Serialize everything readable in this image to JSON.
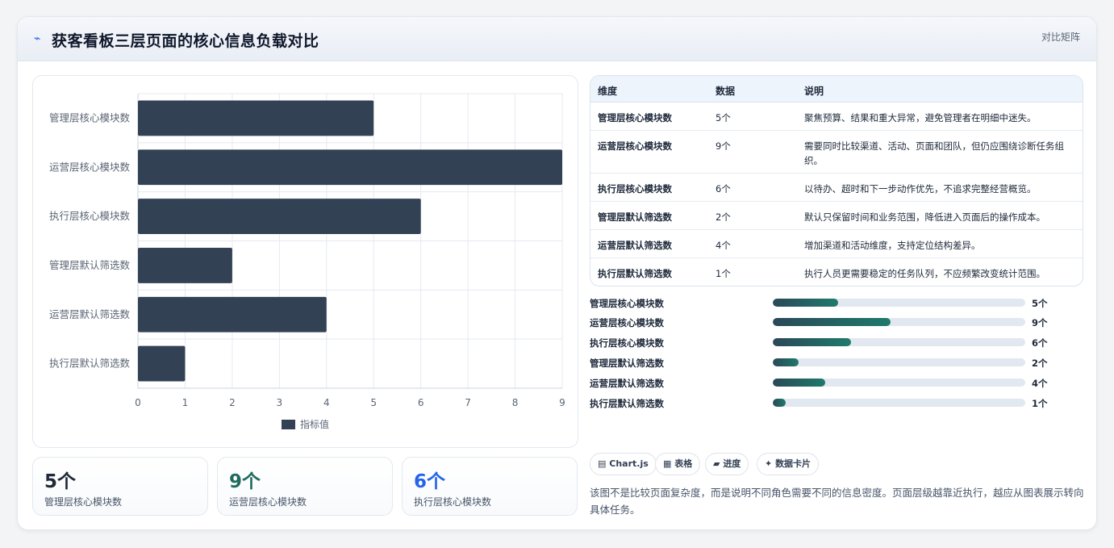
{
  "header": {
    "icon": "spark-icon",
    "title": "获客看板三层页面的核心信息负载对比",
    "tag": "对比矩阵"
  },
  "chart_data": {
    "type": "bar",
    "orientation": "horizontal",
    "categories": [
      "管理层核心模块数",
      "运营层核心模块数",
      "执行层核心模块数",
      "管理层默认筛选数",
      "运营层默认筛选数",
      "执行层默认筛选数"
    ],
    "series": [
      {
        "name": "指标值",
        "values": [
          5,
          9,
          6,
          2,
          4,
          1
        ],
        "color": "#334155"
      }
    ],
    "xlim": [
      0,
      9
    ],
    "x_ticks": [
      "0",
      "1",
      "2",
      "3",
      "4",
      "5",
      "6",
      "7",
      "8",
      "9"
    ],
    "grid": true,
    "legend_position": "bottom"
  },
  "stats": [
    {
      "value": "5个",
      "label": "管理层核心模块数",
      "color": "#1f2937"
    },
    {
      "value": "9个",
      "label": "运营层核心模块数",
      "color": "#1f6b5e"
    },
    {
      "value": "6个",
      "label": "执行层核心模块数",
      "color": "#2563eb"
    }
  ],
  "table": {
    "headers": [
      "维度",
      "数据",
      "说明"
    ],
    "rows": [
      {
        "dim": "管理层核心模块数",
        "val": "5个",
        "desc": "聚焦预算、结果和重大异常，避免管理者在明细中迷失。"
      },
      {
        "dim": "运营层核心模块数",
        "val": "9个",
        "desc": "需要同时比较渠道、活动、页面和团队，但仍应围绕诊断任务组织。"
      },
      {
        "dim": "执行层核心模块数",
        "val": "6个",
        "desc": "以待办、超时和下一步动作优先，不追求完整经营概览。"
      },
      {
        "dim": "管理层默认筛选数",
        "val": "2个",
        "desc": "默认只保留时间和业务范围，降低进入页面后的操作成本。"
      },
      {
        "dim": "运营层默认筛选数",
        "val": "4个",
        "desc": "增加渠道和活动维度，支持定位结构差异。"
      },
      {
        "dim": "执行层默认筛选数",
        "val": "1个",
        "desc": "执行人员更需要稳定的任务队列，不应频繁改变统计范围。"
      }
    ]
  },
  "progress": [
    {
      "label": "管理层核心模块数",
      "value": "5个",
      "fraction": 0.2593
    },
    {
      "label": "运营层核心模块数",
      "value": "9个",
      "fraction": 0.4667
    },
    {
      "label": "执行层核心模块数",
      "value": "6个",
      "fraction": 0.3111
    },
    {
      "label": "管理层默认筛选数",
      "value": "2个",
      "fraction": 0.1037
    },
    {
      "label": "运营层默认筛选数",
      "value": "4个",
      "fraction": 0.2074
    },
    {
      "label": "执行层默认筛选数",
      "value": "1个",
      "fraction": 0.0519
    }
  ],
  "chips": [
    {
      "icon": "chart-icon",
      "glyph": "▤",
      "label": "Chart.js"
    },
    {
      "icon": "table-icon",
      "glyph": "▦",
      "label": "表格"
    },
    {
      "icon": "progress-icon",
      "glyph": "▰",
      "label": "进度"
    },
    {
      "icon": "card-icon",
      "glyph": "✦",
      "label": "数据卡片"
    }
  ],
  "note": "该图不是比较页面复杂度，而是说明不同角色需要不同的信息密度。页面层级越靠近执行，越应从图表展示转向具体任务。"
}
